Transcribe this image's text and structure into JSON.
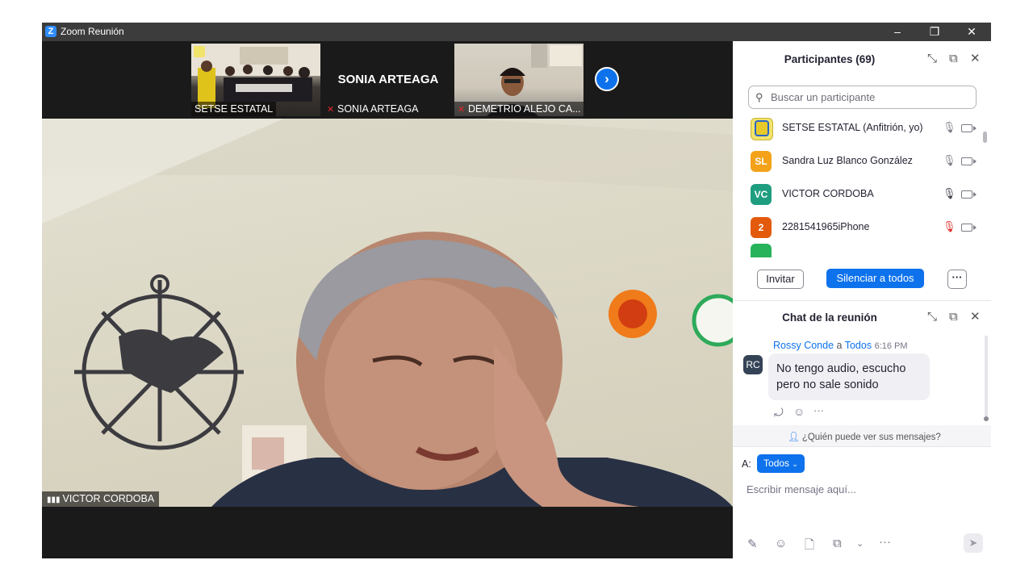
{
  "window": {
    "title": "Zoom Reunión",
    "controls": [
      "–",
      "❐",
      "✕"
    ]
  },
  "video": {
    "tiles": [
      {
        "name": "SETSE ESTATAL",
        "muted": false
      },
      {
        "name": "SONIA ARTEAGA",
        "display_title": "SONIA ARTEAGA",
        "muted": true
      },
      {
        "name": "DEMETRIO ALEJO CA...",
        "muted": true
      }
    ],
    "main_speaker": "VICTOR  CORDOBA"
  },
  "participants": {
    "title": "Participantes (69)",
    "search_placeholder": "Buscar un participante",
    "list": [
      {
        "avatar": "",
        "name": "SETSE ESTATAL (Anfitrión, yo)",
        "avatar_color": "#f2e36a",
        "mic": "on"
      },
      {
        "avatar": "SL",
        "name": "Sandra Luz Blanco González",
        "avatar_color": "#f3a21a",
        "mic": "on"
      },
      {
        "avatar": "VC",
        "name": "VICTOR  CORDOBA",
        "avatar_color": "#1f9d80",
        "mic": "active"
      },
      {
        "avatar": "2",
        "name": "2281541965iPhone",
        "avatar_color": "#e35a0c",
        "mic": "muted"
      }
    ],
    "invite_label": "Invitar",
    "mute_all_label": "Silenciar a todos",
    "more_label": "···"
  },
  "chat": {
    "title": "Chat de la reunión",
    "messages": [
      {
        "sender": "Rossy Conde",
        "connector": "a",
        "recipient": "Todos",
        "time": "6:16 PM",
        "avatar": "RC",
        "text": "No tengo audio, escucho pero no sale sonido"
      }
    ],
    "visibility_note": "¿Quién puede ver sus mensajes?",
    "to_label": "A:",
    "to_value": "Todos",
    "input_placeholder": "Escribir mensaje aquí..."
  }
}
